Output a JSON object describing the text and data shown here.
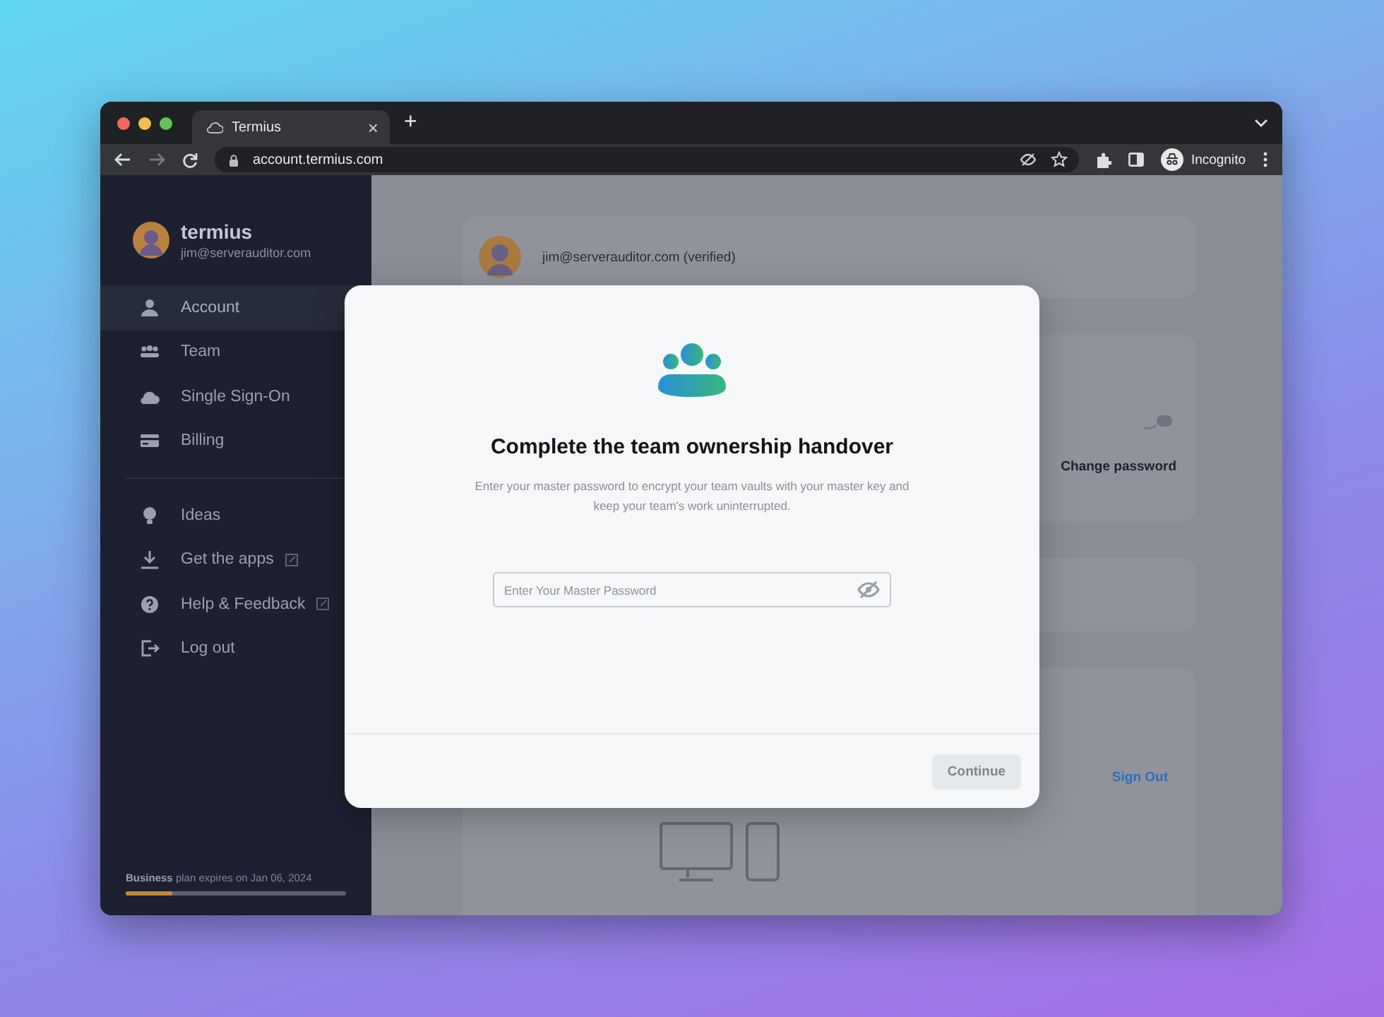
{
  "browser": {
    "tab": {
      "title": "Termius",
      "close": "×"
    },
    "new_tab": "+",
    "address": "account.termius.com",
    "profile": "Incognito"
  },
  "sidebar": {
    "brand": "termius",
    "email": "jim@serverauditor.com",
    "items": [
      {
        "label": "Account",
        "selected": true
      },
      {
        "label": "Team",
        "selected": false
      },
      {
        "label": "Single Sign-On",
        "selected": false
      },
      {
        "label": "Billing",
        "selected": false
      }
    ],
    "links": [
      {
        "label": "Ideas",
        "external": false
      },
      {
        "label": "Get the apps",
        "external": true
      },
      {
        "label": "Help & Feedback",
        "external": true
      },
      {
        "label": "Log out",
        "external": false
      }
    ],
    "plan": {
      "text": "**Business** plan expires on Jan 06, 2024",
      "level": 0.21
    }
  },
  "main": {
    "account_email": "jim@serverauditor.com (verified)",
    "change_password": "Change password",
    "sign_out": "Sign Out"
  },
  "modal": {
    "title": "Complete the team ownership handover",
    "description": "Enter your master password to encrypt your team vaults with your master key and keep your team's work uninterrupted.",
    "password": {
      "placeholder": "Enter Your Master Password"
    },
    "continue": {
      "label": "Continue",
      "disabled": true
    }
  }
}
